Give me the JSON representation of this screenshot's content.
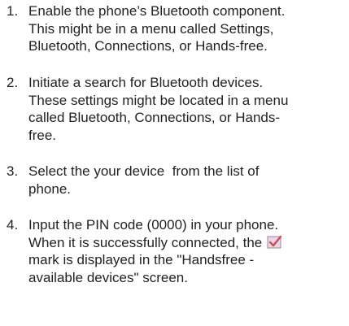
{
  "steps": [
    {
      "number": "1.",
      "lines": [
        "Enable the phone’s Bluetooth component.",
        "This might be in a menu called Settings,",
        "Bluetooth, Connections, or Hands-free."
      ]
    },
    {
      "number": "2.",
      "lines": [
        "Initiate a search for Bluetooth devices.",
        "These settings might be located in a menu",
        "called Bluetooth, Connections, or Hands-",
        "free."
      ]
    },
    {
      "number": "3.",
      "lines": [
        "Select the your device  from the list of",
        "phone."
      ]
    },
    {
      "number": "4.",
      "lines": [
        "Input the PIN code (0000) in your phone."
      ],
      "line_2_before_icon": "When it is successfully connected, the",
      "icon": "checkmark-icon",
      "lines_after_icon": [
        "mark is displayed in the \"Handsfree -",
        "available devices\" screen."
      ]
    }
  ],
  "colors": {
    "text": "#231f20",
    "icon_box": "#e8d7eb",
    "icon_check": "#d64a4a"
  }
}
